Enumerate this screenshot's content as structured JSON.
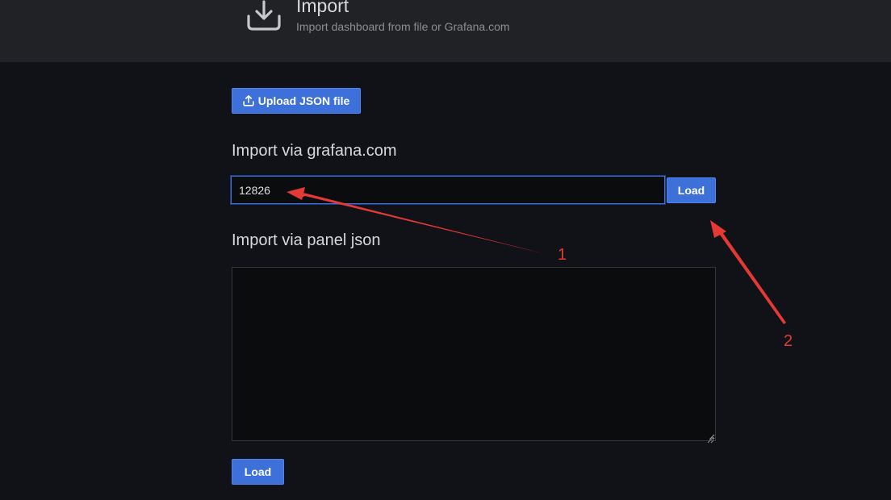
{
  "header": {
    "icon": "import-download-icon",
    "title": "Import",
    "subtitle": "Import dashboard from file or Grafana.com"
  },
  "upload": {
    "icon": "upload-icon",
    "label": "Upload JSON file"
  },
  "grafana_com": {
    "title": "Import via grafana.com",
    "input_value": "12826",
    "load_label": "Load"
  },
  "panel_json": {
    "title": "Import via panel json",
    "value": "",
    "load_label": "Load"
  },
  "annotations": {
    "label_1": "1",
    "label_2": "2",
    "color": "#e53935"
  },
  "colors": {
    "background": "#111217",
    "header_background": "#202226",
    "primary_button": "#3d71d9",
    "input_background": "#0b0c0e"
  }
}
